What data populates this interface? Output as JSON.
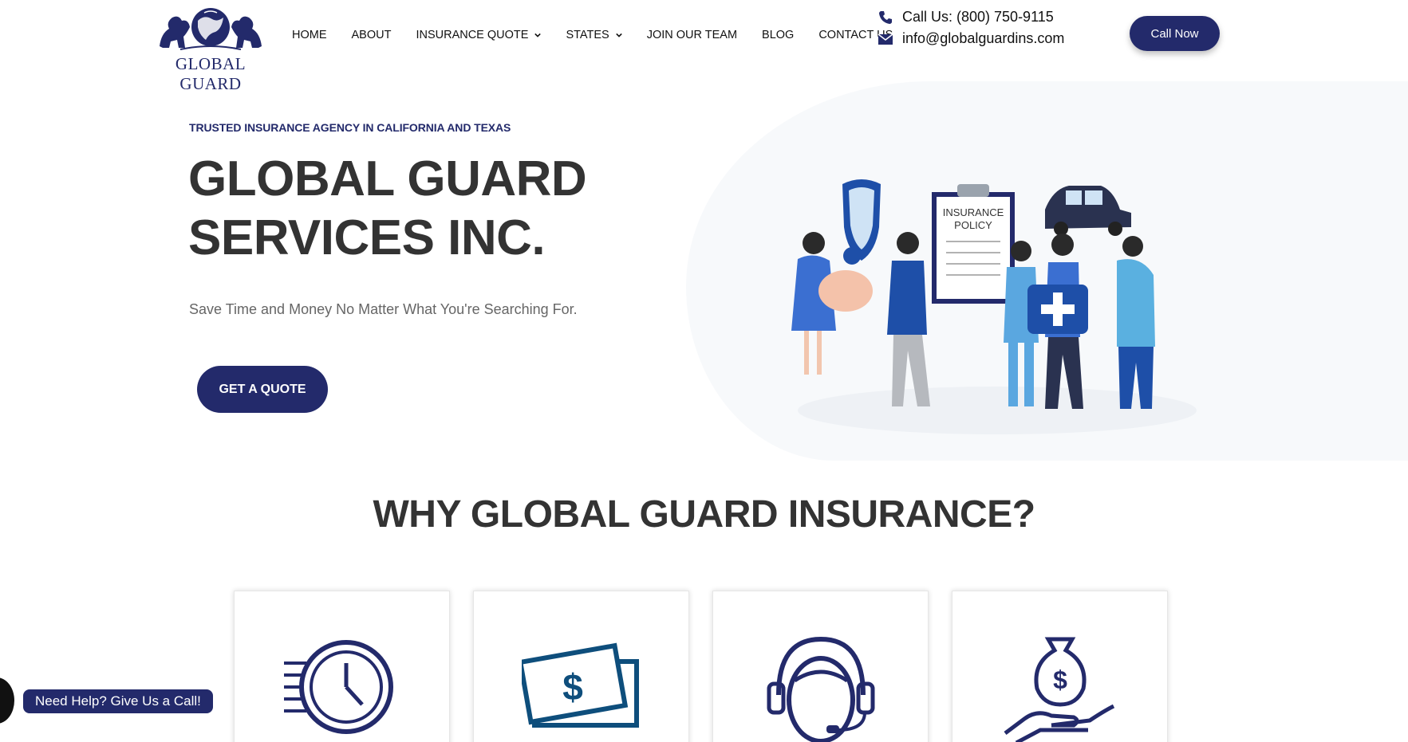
{
  "brand": {
    "name": "GLOBAL GUARD",
    "primary_color": "#232a6b"
  },
  "nav": {
    "items": [
      {
        "label": "HOME",
        "dropdown": false
      },
      {
        "label": "ABOUT",
        "dropdown": false
      },
      {
        "label": "INSURANCE QUOTE",
        "dropdown": true
      },
      {
        "label": "STATES",
        "dropdown": true
      },
      {
        "label": "JOIN OUR TEAM",
        "dropdown": false
      },
      {
        "label": "BLOG",
        "dropdown": false
      },
      {
        "label": "CONTACT US",
        "dropdown": false
      }
    ]
  },
  "contact": {
    "phone": "Call Us: (800) 750-9115",
    "email": "info@globalguardins.com",
    "phone_icon": "phone-icon",
    "email_icon": "envelope-icon"
  },
  "header": {
    "call_button": "Call Now"
  },
  "hero": {
    "tagline": "TRUSTED INSURANCE AGENCY IN CALIFORNIA AND TEXAS",
    "title_line1": "GLOBAL GUARD",
    "title_line2": "SERVICES INC.",
    "subtitle": "Save Time and Money No Matter What You're Searching For.",
    "cta": "GET A QUOTE",
    "illustration_text1": "INSURANCE",
    "illustration_text2": "POLICY"
  },
  "why": {
    "title": "WHY GLOBAL GUARD INSURANCE?",
    "cards": [
      {
        "icon": "clock-icon"
      },
      {
        "icon": "cash-icon"
      },
      {
        "icon": "headset-support-icon"
      },
      {
        "icon": "money-bag-hand-icon"
      }
    ]
  },
  "help_widget": {
    "label": "Need Help? Give Us a Call!"
  }
}
